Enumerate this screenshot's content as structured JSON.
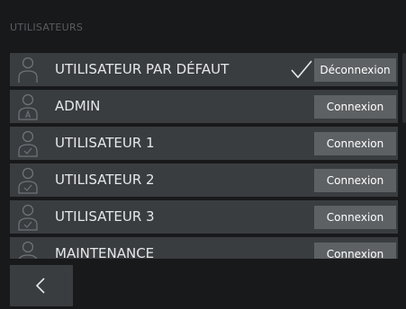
{
  "screen": {
    "section_title": "UTILISATEURS"
  },
  "users": [
    {
      "name": "UTILISATEUR PAR DÉFAUT",
      "action": "Déconnexion",
      "active": true,
      "icon": "user-default-icon"
    },
    {
      "name": "ADMIN",
      "action": "Connexion",
      "active": false,
      "icon": "user-admin-icon"
    },
    {
      "name": "UTILISATEUR 1",
      "action": "Connexion",
      "active": false,
      "icon": "user-check-icon"
    },
    {
      "name": "UTILISATEUR 2",
      "action": "Connexion",
      "active": false,
      "icon": "user-check-icon"
    },
    {
      "name": "UTILISATEUR 3",
      "action": "Connexion",
      "active": false,
      "icon": "user-check-icon"
    },
    {
      "name": "MAINTENANCE",
      "action": "Connexion",
      "active": false,
      "icon": "user-icon"
    }
  ],
  "active_indicator": "checkmark-icon",
  "navigation": {
    "back_icon": "chevron-left-icon"
  },
  "colors": {
    "background": "#18191b",
    "row": "#3a3d40",
    "button": "#5e6164",
    "text": "#e6e7e8",
    "icon": "#6f7276"
  }
}
